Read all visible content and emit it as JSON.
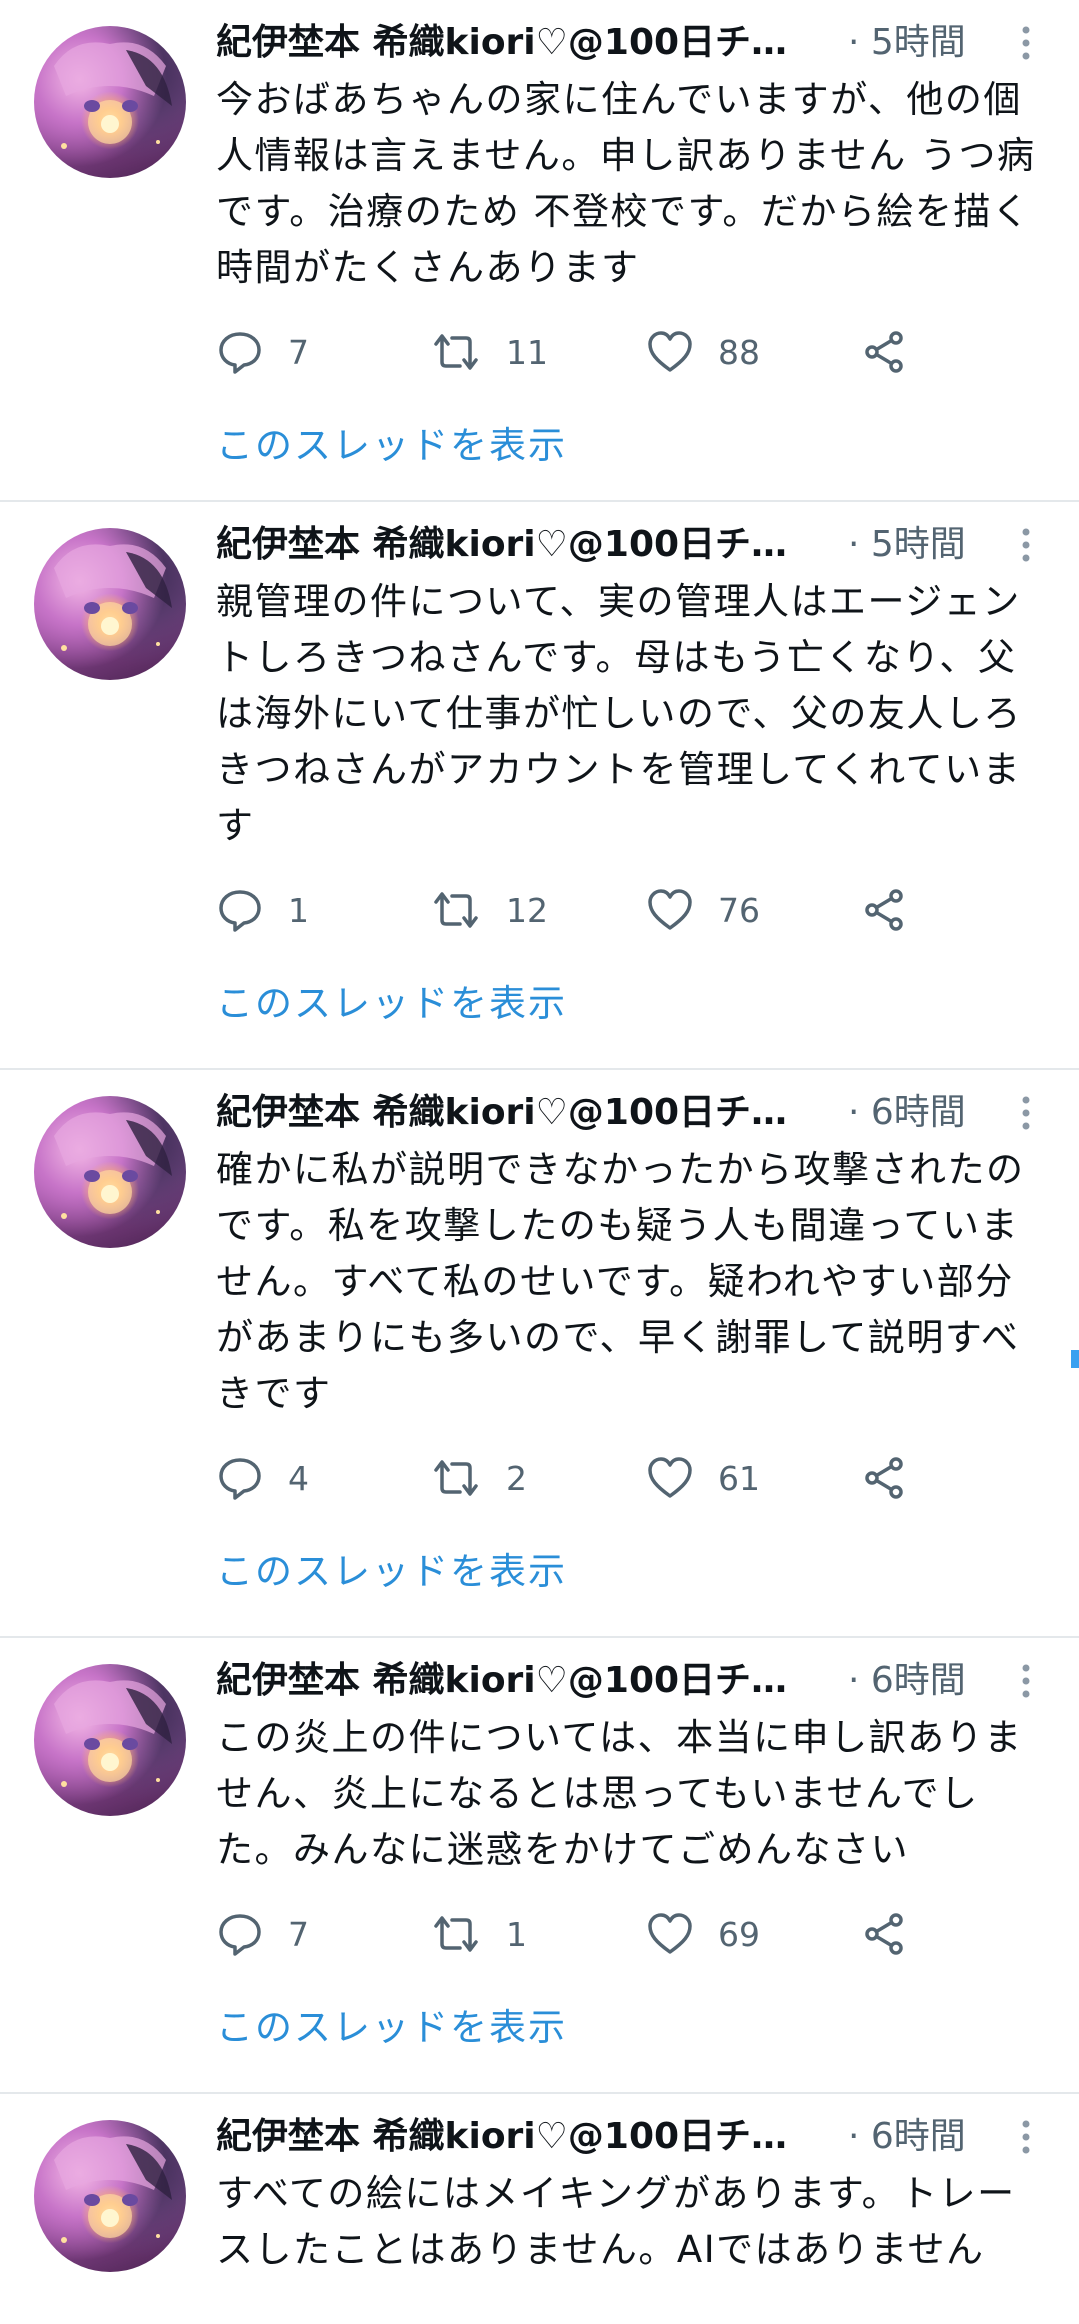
{
  "accent_color": "#2a8ed8",
  "icons": {
    "reply": "reply-icon",
    "retweet": "retweet-icon",
    "like": "heart-icon",
    "share": "share-icon",
    "more": "more-vertical-icon"
  },
  "tweets": [
    {
      "display_name": "紀伊埜本 希織kiori♡@100日チ…",
      "time": "· 5時間",
      "text": "今おばあちゃんの家に住んでいますが、他の個人情報は言えません。申し訳ありません うつ病です。治療のため 不登校です。だから絵を描く時間がたくさんあります",
      "replies": "7",
      "retweets": "11",
      "likes": "88",
      "thread_label": "このスレッドを表示"
    },
    {
      "display_name": "紀伊埜本 希織kiori♡@100日チ…",
      "time": "· 5時間",
      "text": "親管理の件について、実の管理人はエージェントしろきつねさんです。母はもう亡くなり、父は海外にいて仕事が忙しいので、父の友人しろきつねさんがアカウントを管理してくれています",
      "replies": "1",
      "retweets": "12",
      "likes": "76",
      "thread_label": "このスレッドを表示"
    },
    {
      "display_name": "紀伊埜本 希織kiori♡@100日チ…",
      "time": "· 6時間",
      "text": "確かに私が説明できなかったから攻撃されたのです。私を攻撃したのも疑う人も間違っていません。すべて私のせいです。疑われやすい部分があまりにも多いので、早く謝罪して説明すべきです",
      "replies": "4",
      "retweets": "2",
      "likes": "61",
      "thread_label": "このスレッドを表示"
    },
    {
      "display_name": "紀伊埜本 希織kiori♡@100日チ…",
      "time": "· 6時間",
      "text": "この炎上の件については、本当に申し訳ありません、炎上になるとは思ってもいませんでした。みんなに迷惑をかけてごめんなさい",
      "replies": "7",
      "retweets": "1",
      "likes": "69",
      "thread_label": "このスレッドを表示"
    },
    {
      "display_name": "紀伊埜本 希織kiori♡@100日チ…",
      "time": "· 6時間",
      "text": "すべての絵にはメイキングがあります。トレースしたことはありません。AIではありません"
    }
  ]
}
